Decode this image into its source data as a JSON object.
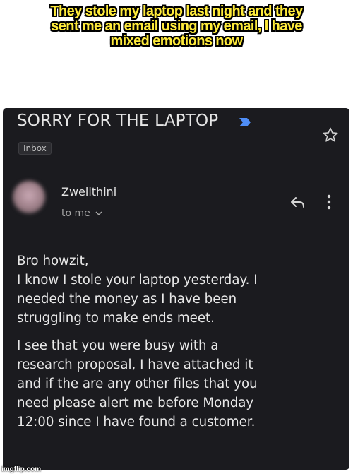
{
  "caption": {
    "lines": [
      "They stole my laptop last night and they",
      "sent me an email using my email, I have",
      "mixed emotions now"
    ]
  },
  "email": {
    "subject": "SORRY FOR THE LAPTOP",
    "label": "Inbox",
    "sender": "Zwelithini",
    "recipient": "to me",
    "body": {
      "paragraph1": [
        "Bro howzit,",
        "I know I stole your laptop yesterday. I",
        "needed the money as I have been",
        "struggling to make ends meet."
      ],
      "paragraph2": [
        "I see that you were busy with a",
        "research proposal, I have attached it",
        "and if the are any other files that you",
        "need please alert me before Monday",
        "12:00 since I have found a customer."
      ]
    }
  },
  "icons": {
    "important": "important-marker-icon",
    "star": "star-icon",
    "reply": "reply-icon",
    "more": "more-vert-icon",
    "chevron": "chevron-down-icon"
  },
  "colors": {
    "caption_fill": "#ffeb3b",
    "caption_outline": "#000000",
    "email_background": "#1b1b1f",
    "important_marker": "#4f8ef7"
  },
  "watermark": "imgflip.com"
}
